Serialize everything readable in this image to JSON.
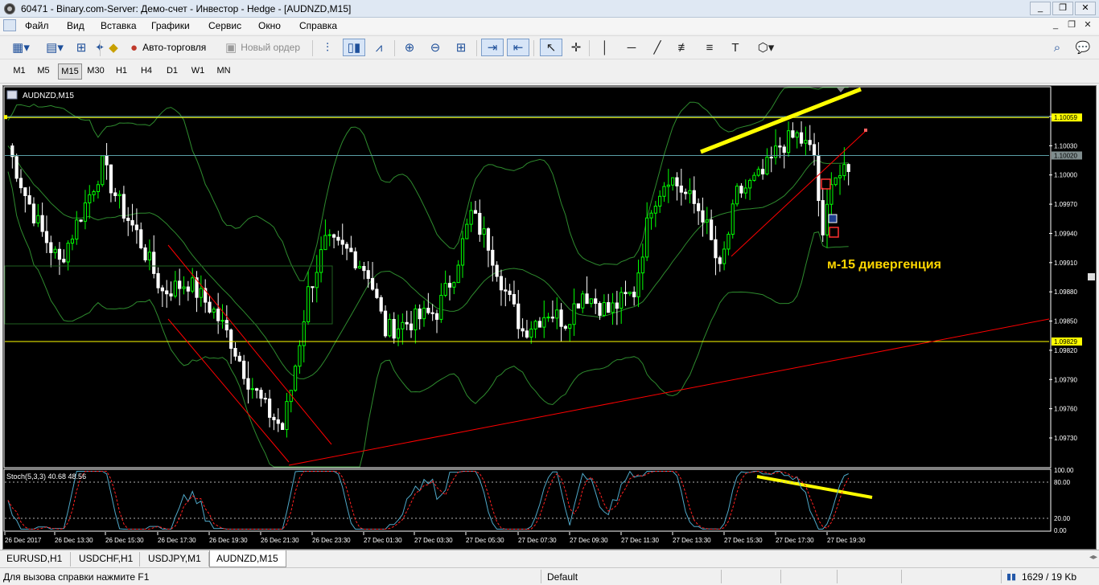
{
  "window": {
    "title": "60471 - Binary.com-Server: Демо-счет - Инвестор - Hedge - [AUDNZD,M15]",
    "buttons": [
      "_",
      "❐",
      "✕"
    ]
  },
  "menu": {
    "items": [
      "Файл",
      "Вид",
      "Вставка",
      "Графики",
      "Сервис",
      "Окно",
      "Справка"
    ],
    "mdi": [
      "_",
      "❐",
      "✕"
    ]
  },
  "toolbar": {
    "autotrade_label": "Авто-торговля",
    "new_order_label": "Новый ордер",
    "icons": [
      "new-chart-icon",
      "profiles-icon",
      "market-watch-icon",
      "navigator-icon",
      "autotrade-icon",
      "new-order-icon",
      "bar-chart-icon",
      "candle-chart-icon",
      "line-chart-icon",
      "zoom-in-icon",
      "zoom-out-icon",
      "tile-icon",
      "autoscroll-icon",
      "chart-shift-icon",
      "cursor-icon",
      "crosshair-icon",
      "vline-icon",
      "hline-icon",
      "trendline-icon",
      "fibo-icon",
      "fibo-fan-icon",
      "text-icon",
      "shapes-icon",
      "search-icon",
      "chat-icon"
    ]
  },
  "timeframes": [
    "M1",
    "M5",
    "M15",
    "M30",
    "H1",
    "H4",
    "D1",
    "W1",
    "MN"
  ],
  "active_timeframe": "M15",
  "chart": {
    "symbol_label": "AUDNZD,M15",
    "annotation": "м-15 дивергенция",
    "indicator_label": "Stoch(5,3,3) 40.68 48.56",
    "price_labels": [
      "1.10060",
      "1.10030",
      "1.10000",
      "1.09970",
      "1.09940",
      "1.09910",
      "1.09880",
      "1.09850",
      "1.09820",
      "1.09790",
      "1.09760",
      "1.09730"
    ],
    "badges": [
      {
        "text": "1.10059",
        "price": 1.10059,
        "color": "#ffff00"
      },
      {
        "text": "1.10020",
        "price": 1.1002,
        "color": "#7f8c8d"
      },
      {
        "text": "1.09829",
        "price": 1.09829,
        "color": "#ffff00"
      }
    ],
    "stoch_labels": [
      "100.00",
      "80.00",
      "20.00",
      "0.00"
    ],
    "time_labels": [
      "26 Dec 2017",
      "26 Dec 13:30",
      "26 Dec 15:30",
      "26 Dec 17:30",
      "26 Dec 19:30",
      "26 Dec 21:30",
      "26 Dec 23:30",
      "27 Dec 01:30",
      "27 Dec 03:30",
      "27 Dec 05:30",
      "27 Dec 07:30",
      "27 Dec 09:30",
      "27 Dec 11:30",
      "27 Dec 13:30",
      "27 Dec 15:30",
      "27 Dec 17:30",
      "27 Dec 19:30"
    ],
    "colors": {
      "bg": "#000000",
      "bull": "#00ff00",
      "bear": "#ffffff",
      "band": "#2e8b2e",
      "level": "#ffff00",
      "trend": "#ff0000"
    }
  },
  "chart_data": {
    "type": "candlestick",
    "symbol": "AUDNZD",
    "timeframe": "M15",
    "ylim": [
      1.0971,
      1.1008
    ],
    "yticks": [
      1.1006,
      1.1003,
      1.1,
      1.0997,
      1.0994,
      1.0991,
      1.0988,
      1.0985,
      1.0982,
      1.0979,
      1.0976,
      1.0973
    ],
    "close_path": [
      [
        0,
        1.1003
      ],
      [
        4,
        1.0998
      ],
      [
        8,
        1.0994
      ],
      [
        12,
        1.0991
      ],
      [
        16,
        1.0995
      ],
      [
        22,
        1.1001
      ],
      [
        26,
        1.0997
      ],
      [
        30,
        1.0994
      ],
      [
        36,
        1.0988
      ],
      [
        42,
        1.0989
      ],
      [
        48,
        1.0986
      ],
      [
        52,
        1.0983
      ],
      [
        56,
        1.0979
      ],
      [
        60,
        1.0976
      ],
      [
        64,
        1.0974
      ],
      [
        66,
        1.0978
      ],
      [
        70,
        1.0988
      ],
      [
        74,
        1.0993
      ],
      [
        80,
        1.0992
      ],
      [
        84,
        1.099
      ],
      [
        88,
        1.0984
      ],
      [
        94,
        1.0985
      ],
      [
        100,
        1.0986
      ],
      [
        104,
        1.099
      ],
      [
        108,
        1.0996
      ],
      [
        112,
        1.0993
      ],
      [
        116,
        1.0988
      ],
      [
        120,
        1.0984
      ],
      [
        126,
        1.0986
      ],
      [
        130,
        1.0985
      ],
      [
        134,
        1.0988
      ],
      [
        140,
        1.0986
      ],
      [
        146,
        1.0988
      ],
      [
        150,
        1.0997
      ],
      [
        154,
        1.1
      ],
      [
        158,
        1.0998
      ],
      [
        162,
        1.0996
      ],
      [
        166,
        1.099
      ],
      [
        170,
        1.0998
      ],
      [
        176,
        1.1
      ],
      [
        180,
        1.1003
      ],
      [
        184,
        1.1004
      ],
      [
        188,
        1.1002
      ],
      [
        190,
        1.0993
      ],
      [
        192,
        1.1
      ]
    ],
    "horizontal_levels": [
      1.10059,
      1.09829
    ],
    "stochastic": {
      "name": "Stoch(5,3,3)",
      "main": 40.68,
      "signal": 48.56,
      "levels": [
        80,
        20
      ],
      "ylim": [
        0,
        100
      ]
    }
  }
}
